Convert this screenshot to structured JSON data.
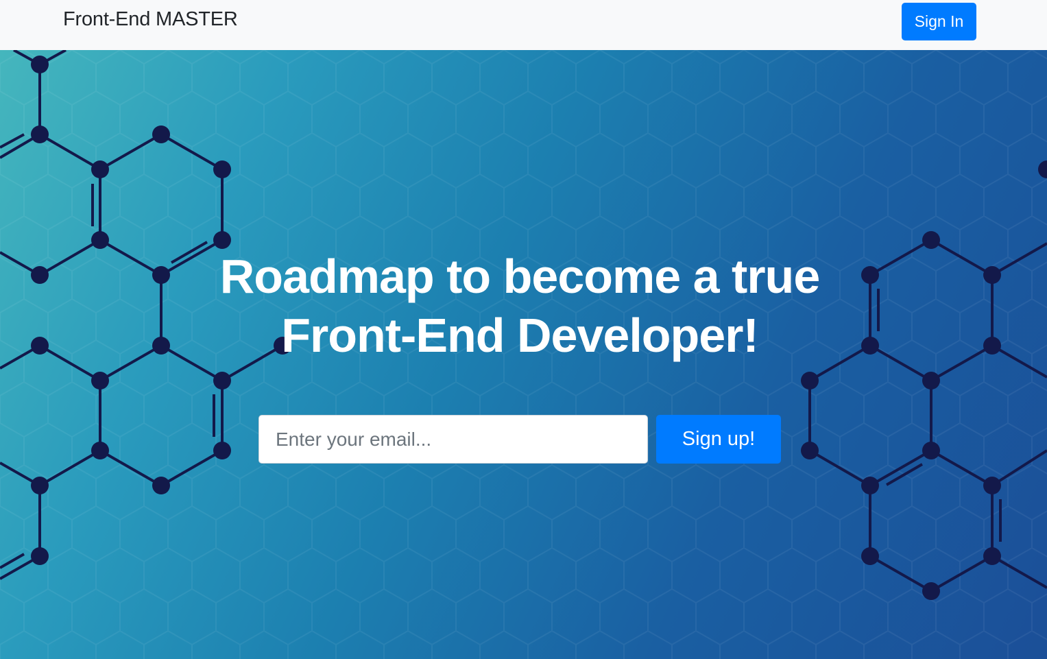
{
  "navbar": {
    "brand": "Front-End MASTER",
    "signin_label": "Sign In"
  },
  "hero": {
    "headline_line1": "Roadmap to become a true",
    "headline_line2": "Front-End Developer!",
    "email_placeholder": "Enter your email...",
    "signup_label": "Sign up!"
  },
  "colors": {
    "primary": "#007bff",
    "navbar_bg": "#f8f9fa",
    "molecule": "#13194a"
  }
}
